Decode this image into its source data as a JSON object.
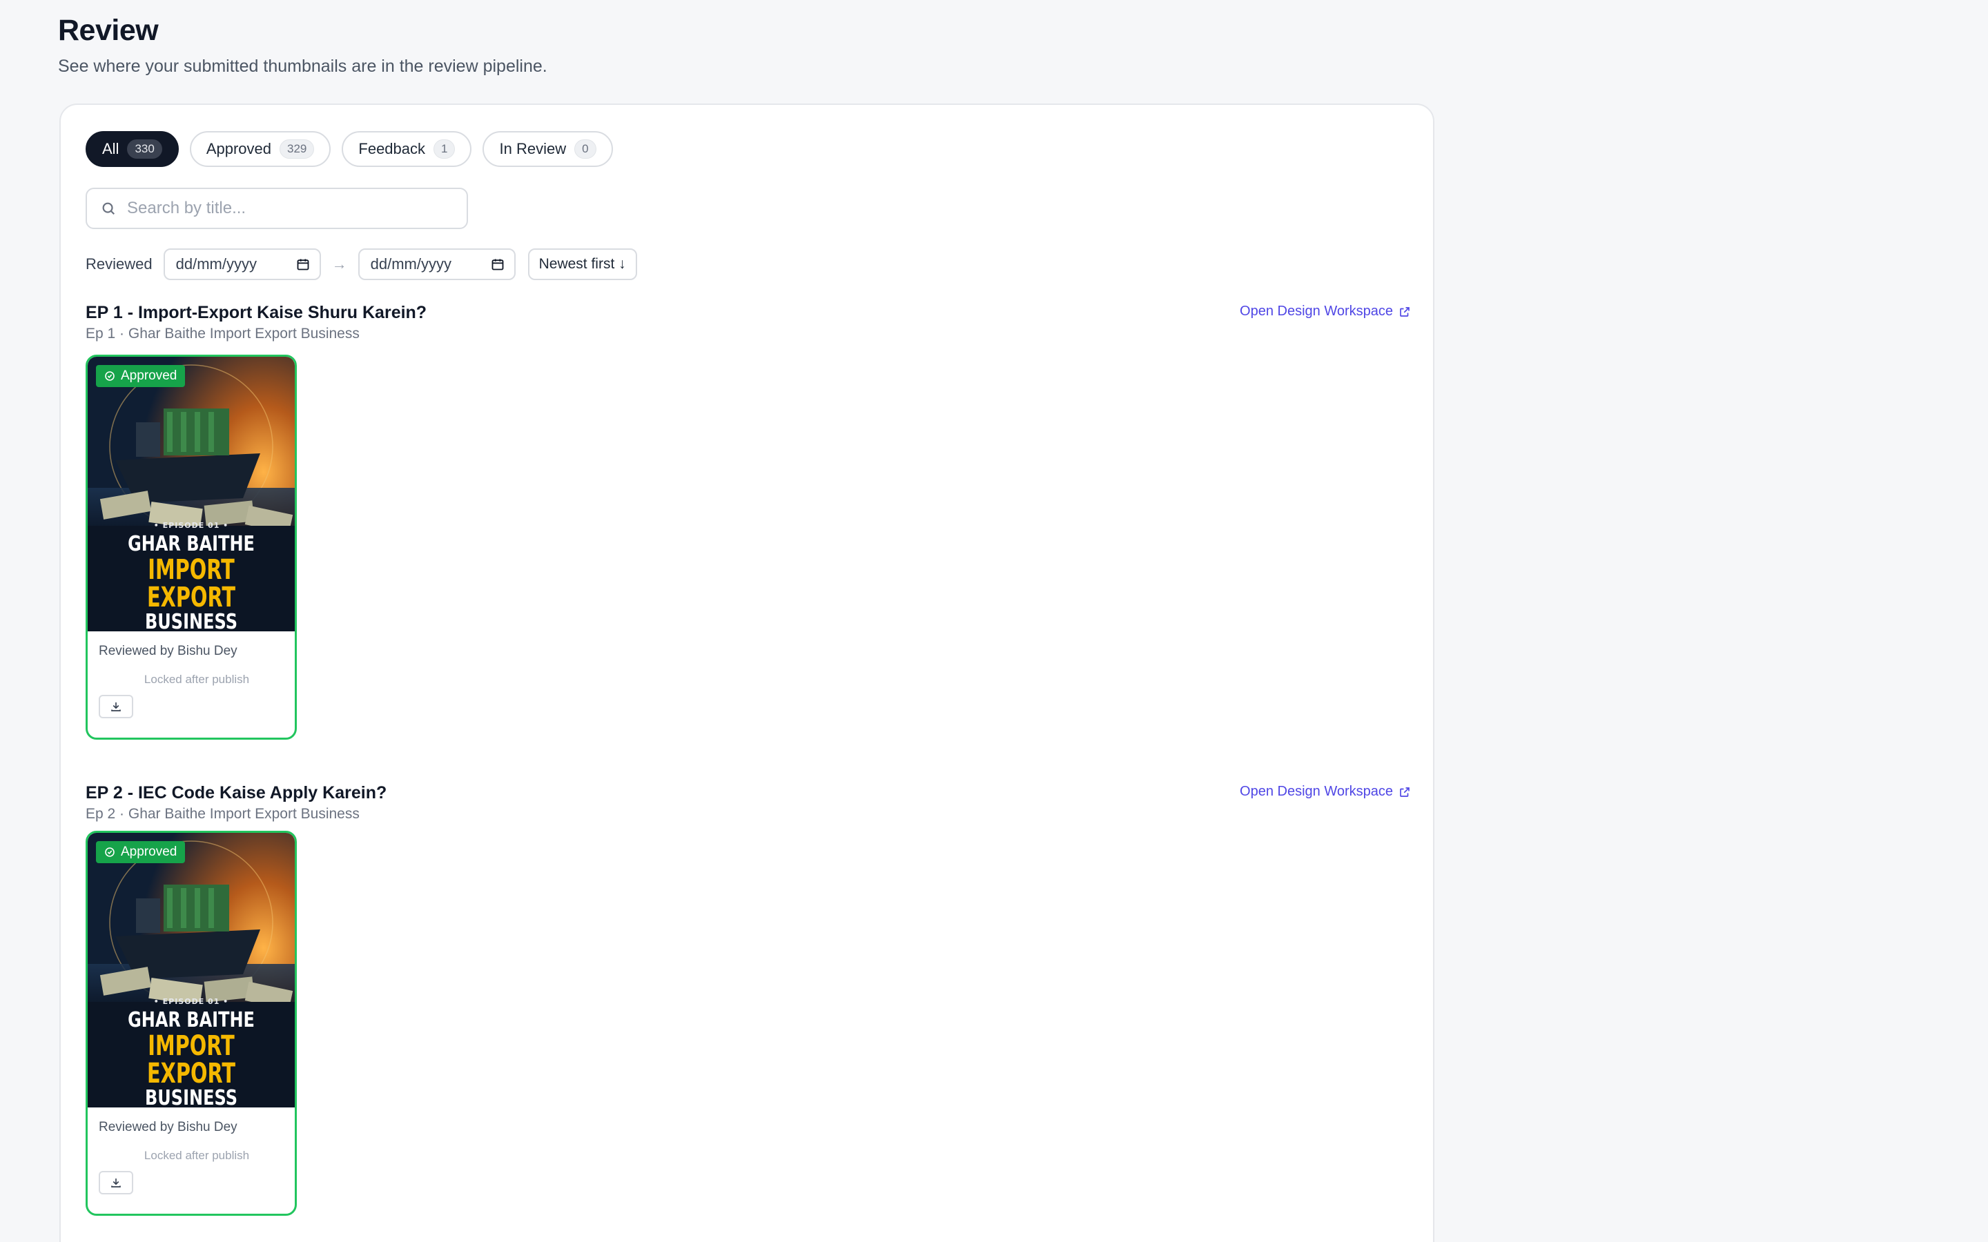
{
  "header": {
    "title": "Review",
    "subtitle": "See where your submitted thumbnails are in the review pipeline."
  },
  "tabs": [
    {
      "label": "All",
      "count": "330",
      "active": true
    },
    {
      "label": "Approved",
      "count": "329"
    },
    {
      "label": "Feedback",
      "count": "1"
    },
    {
      "label": "In Review",
      "count": "0"
    }
  ],
  "search": {
    "placeholder": "Search by title..."
  },
  "filters": {
    "reviewed_label": "Reviewed",
    "from_date": "dd/mm/yyyy",
    "range_arrow": "→",
    "to_date": "dd/mm/yyyy",
    "sort": "Newest first ↓"
  },
  "episodes": [
    {
      "title": "EP 1 - Import-Export Kaise Shuru Karein?",
      "subtitle": "Ep 1 · Ghar Baithe Import Export Business",
      "workspace_link": "Open Design Workspace",
      "thumbnail": {
        "status": "Approved",
        "episode_tag": "• EPISODE 01 •",
        "line1": "GHAR BAITHE",
        "line2": "IMPORT EXPORT",
        "line3": "BUSINESS"
      },
      "reviewed_by": "Reviewed by Bishu Dey",
      "locked_text": "Locked after publish"
    },
    {
      "title": "EP 2 - IEC Code Kaise Apply Karein?",
      "subtitle": "Ep 2 · Ghar Baithe Import Export Business",
      "workspace_link": "Open Design Workspace",
      "thumbnail": {
        "status": "Approved",
        "episode_tag": "• EPISODE 01 •",
        "line1": "GHAR BAITHE",
        "line2": "IMPORT EXPORT",
        "line3": "BUSINESS"
      },
      "reviewed_by": "Reviewed by Bishu Dey",
      "locked_text": "Locked after publish"
    }
  ],
  "colors": {
    "accent_link": "#4f46e5",
    "approved_green": "#16a34a",
    "card_border": "#22c55e",
    "active_tab": "#111827",
    "thumb_gold": "#f5b800"
  }
}
